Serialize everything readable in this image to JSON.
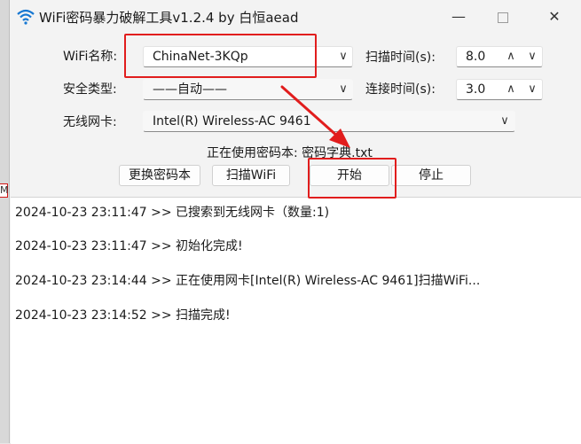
{
  "window": {
    "title": "WiFi密码暴力破解工具v1.2.4 by 白恒aead"
  },
  "form": {
    "wifi_name": {
      "label": "WiFi名称:",
      "value": "ChinaNet-3KQp"
    },
    "security_type": {
      "label": "安全类型:",
      "value": "——自动——"
    },
    "wireless_card": {
      "label": "无线网卡:",
      "value": "Intel(R) Wireless-AC 9461"
    },
    "scan_time": {
      "label": "扫描时间(s):",
      "value": "8.0"
    },
    "connect_time": {
      "label": "连接时间(s):",
      "value": "3.0"
    },
    "dictionary": "正在使用密码本: 密码字典.txt"
  },
  "buttons": {
    "change_dict": "更换密码本",
    "scan_wifi": "扫描WiFi",
    "start": "开始",
    "stop": "停止"
  },
  "log": [
    "2024-10-23 23:11:47 >> 已搜索到无线网卡（数量:1)",
    "2024-10-23 23:11:47 >> 初始化完成!",
    "2024-10-23 23:14:44 >> 正在使用网卡[Intel(R) Wireless-AC 9461]扫描WiFi...",
    "2024-10-23 23:14:52 >> 扫描完成!"
  ],
  "background_fragment": "M",
  "colors": {
    "annotation_red": "#e11d1d",
    "log_bg": "#ffffff",
    "window_bg": "#f3f3f3"
  },
  "icons": [
    "wifi-icon",
    "minimize-icon",
    "maximize-icon",
    "close-icon",
    "chevron-down-icon",
    "spin-up-icon",
    "spin-down-icon"
  ]
}
